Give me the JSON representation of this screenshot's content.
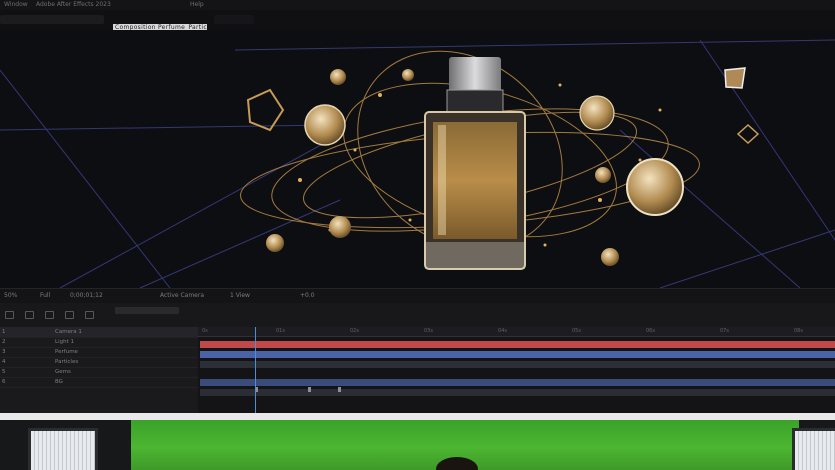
{
  "menu_bar": {
    "items": [
      "Window",
      "Adobe After Effects 2023",
      "Help"
    ]
  },
  "tab_bar": {
    "active_composition_tab": "Composition Perfume_Particles"
  },
  "viewer": {
    "status_items": [
      "Full",
      "Active Camera",
      "1 View",
      "+0.0"
    ],
    "zoom": "50%",
    "timecode": "0;00;01;12"
  },
  "timeline": {
    "ruler_labels": [
      "0s",
      "01s",
      "02s",
      "03s",
      "04s",
      "05s",
      "06s",
      "07s",
      "08s"
    ],
    "layers": [
      {
        "num": "1",
        "name": "Camera 1",
        "color": "#c04a4a"
      },
      {
        "num": "2",
        "name": "Light 1",
        "color": "#4a62a6"
      },
      {
        "num": "3",
        "name": "Perfume",
        "color": "#3d4148"
      },
      {
        "num": "4",
        "name": "Particles",
        "color": "#3a4d7a"
      },
      {
        "num": "5",
        "name": "Gems",
        "color": "#3a3f46"
      },
      {
        "num": "6",
        "name": "BG",
        "color": "#2b2e33"
      }
    ]
  },
  "colors": {
    "accent_gold": "#d4a24a",
    "timeline_red": "#c04a4a",
    "timeline_blue": "#4a62a6",
    "greenscreen": "#44ab2e"
  }
}
